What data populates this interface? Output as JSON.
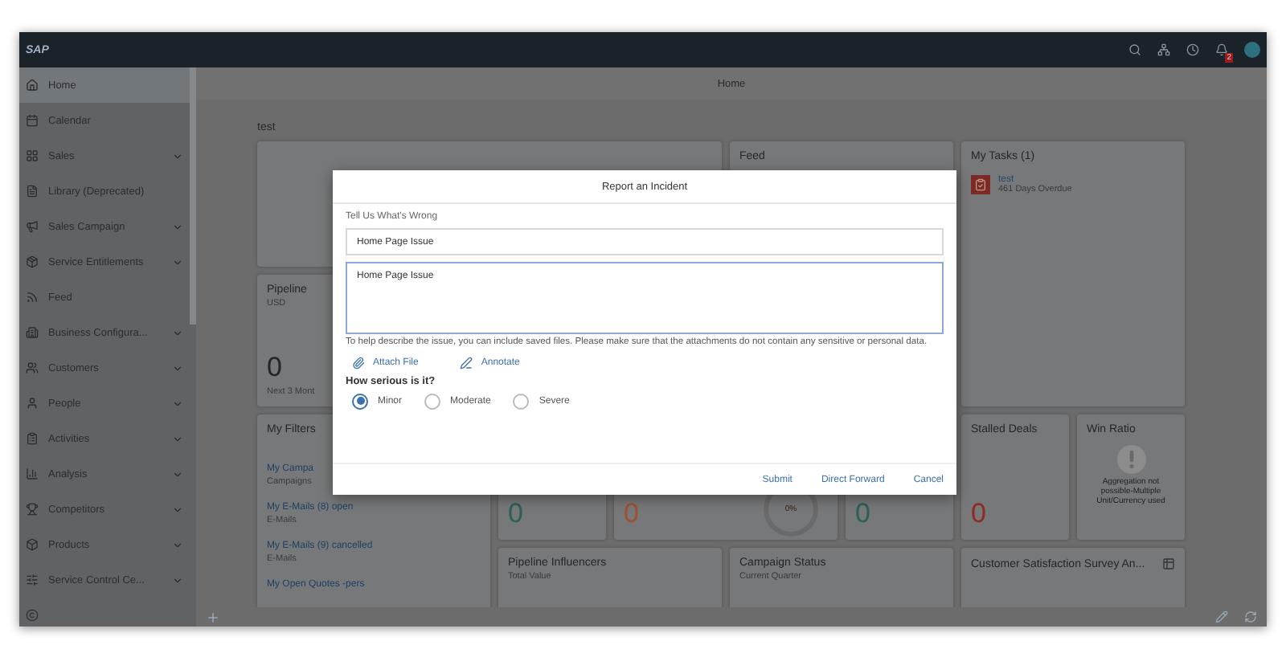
{
  "app": {
    "logo": "SAP",
    "notification_count": "2",
    "page_title": "Home"
  },
  "sidebar": {
    "items": [
      {
        "label": "Home",
        "selected": true,
        "expandable": false
      },
      {
        "label": "Calendar",
        "selected": false,
        "expandable": false
      },
      {
        "label": "Sales",
        "selected": false,
        "expandable": true
      },
      {
        "label": "Library (Deprecated)",
        "selected": false,
        "expandable": false
      },
      {
        "label": "Sales Campaign",
        "selected": false,
        "expandable": true
      },
      {
        "label": "Service Entitlements",
        "selected": false,
        "expandable": true
      },
      {
        "label": "Feed",
        "selected": false,
        "expandable": false
      },
      {
        "label": "Business Configura...",
        "selected": false,
        "expandable": true
      },
      {
        "label": "Customers",
        "selected": false,
        "expandable": true
      },
      {
        "label": "People",
        "selected": false,
        "expandable": true
      },
      {
        "label": "Activities",
        "selected": false,
        "expandable": true
      },
      {
        "label": "Analysis",
        "selected": false,
        "expandable": true
      },
      {
        "label": "Competitors",
        "selected": false,
        "expandable": true
      },
      {
        "label": "Products",
        "selected": false,
        "expandable": true
      },
      {
        "label": "Service Control Ce...",
        "selected": false,
        "expandable": true
      }
    ]
  },
  "content": {
    "heading": "test",
    "feed_card": {
      "title": "Feed"
    },
    "tasks_card": {
      "title": "My Tasks (1)",
      "tasks": [
        {
          "title": "test",
          "status": "461 Days Overdue"
        }
      ]
    },
    "pipeline_card": {
      "title": "Pipeline",
      "subtitle": "USD",
      "value": "0",
      "footer": "Next 3 Mont"
    },
    "filters_card": {
      "title": "My Filters",
      "items": [
        {
          "link": "My Campa",
          "sub": "Campaigns"
        },
        {
          "link": "My E-Mails (8) open",
          "sub": "E-Mails"
        },
        {
          "link": "My E-Mails (9) cancelled",
          "sub": "E-Mails"
        },
        {
          "link": "My Open Quotes -pers"
        }
      ]
    },
    "kpi_tiles": [
      {
        "kind": "number",
        "value": "0",
        "color": "#2c5f5b"
      },
      {
        "kind": "donut",
        "value": "0",
        "color": "#a0502f",
        "donut_label": "0%"
      },
      {
        "kind": "number",
        "value": "0",
        "color": "#2c5f5b"
      },
      {
        "kind": "number",
        "title": "Stalled Deals",
        "value": "0",
        "color": "#8f2a22"
      },
      {
        "kind": "message",
        "title": "Win Ratio",
        "message": "Aggregation not possible-Multiple Unit/Currency used"
      }
    ],
    "bottom_cards": [
      {
        "title": "Pipeline Influencers",
        "subtitle": "Total Value",
        "table_icon": false
      },
      {
        "title": "Campaign Status",
        "subtitle": "Current Quarter",
        "table_icon": false
      },
      {
        "title": "Customer Satisfaction Survey An...",
        "table_icon": true
      }
    ]
  },
  "dialog": {
    "title": "Report an Incident",
    "field_label": "Tell Us What's Wrong",
    "subject": "Home Page Issue",
    "description": "Home Page Issue",
    "help_text": "To help describe the issue, you can include saved files. Please make sure that the attachments do not contain any sensitive or personal data.",
    "actions": [
      "Attach File",
      "Annotate"
    ],
    "severity_label": "How serious is it?",
    "severity_options": [
      {
        "label": "Minor",
        "selected": true
      },
      {
        "label": "Moderate",
        "selected": false
      },
      {
        "label": "Severe",
        "selected": false
      }
    ],
    "buttons": [
      "Submit",
      "Direct Forward",
      "Cancel"
    ]
  }
}
